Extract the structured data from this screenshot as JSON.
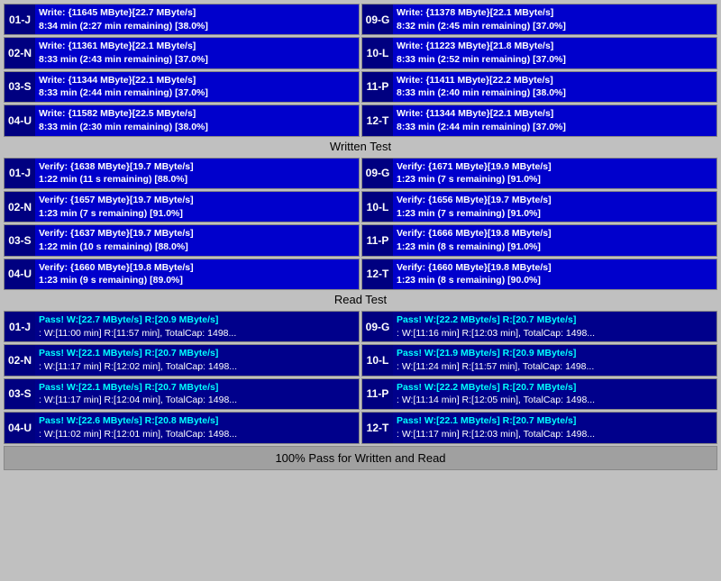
{
  "sections": {
    "write_label": "Written Test",
    "read_label": "Read Test",
    "pass_label": "100% Pass for Written and Read"
  },
  "write_rows": [
    {
      "left": {
        "id": "01-J",
        "line1": "Write: {11645 MByte}[22.7 MByte/s]",
        "line2": "8:34 min (2:27 min remaining)  [38.0%]"
      },
      "right": {
        "id": "09-G",
        "line1": "Write: {11378 MByte}[22.1 MByte/s]",
        "line2": "8:32 min (2:45 min remaining)  [37.0%]"
      }
    },
    {
      "left": {
        "id": "02-N",
        "line1": "Write: {11361 MByte}[22.1 MByte/s]",
        "line2": "8:33 min (2:43 min remaining)  [37.0%]"
      },
      "right": {
        "id": "10-L",
        "line1": "Write: {11223 MByte}[21.8 MByte/s]",
        "line2": "8:33 min (2:52 min remaining)  [37.0%]"
      }
    },
    {
      "left": {
        "id": "03-S",
        "line1": "Write: {11344 MByte}[22.1 MByte/s]",
        "line2": "8:33 min (2:44 min remaining)  [37.0%]"
      },
      "right": {
        "id": "11-P",
        "line1": "Write: {11411 MByte}[22.2 MByte/s]",
        "line2": "8:33 min (2:40 min remaining)  [38.0%]"
      }
    },
    {
      "left": {
        "id": "04-U",
        "line1": "Write: {11582 MByte}[22.5 MByte/s]",
        "line2": "8:33 min (2:30 min remaining)  [38.0%]"
      },
      "right": {
        "id": "12-T",
        "line1": "Write: {11344 MByte}[22.1 MByte/s]",
        "line2": "8:33 min (2:44 min remaining)  [37.0%]"
      }
    }
  ],
  "verify_rows": [
    {
      "left": {
        "id": "01-J",
        "line1": "Verify: {1638 MByte}[19.7 MByte/s]",
        "line2": "1:22 min (11 s remaining)  [88.0%]"
      },
      "right": {
        "id": "09-G",
        "line1": "Verify: {1671 MByte}[19.9 MByte/s]",
        "line2": "1:23 min (7 s remaining)  [91.0%]"
      }
    },
    {
      "left": {
        "id": "02-N",
        "line1": "Verify: {1657 MByte}[19.7 MByte/s]",
        "line2": "1:23 min (7 s remaining)  [91.0%]"
      },
      "right": {
        "id": "10-L",
        "line1": "Verify: {1656 MByte}[19.7 MByte/s]",
        "line2": "1:23 min (7 s remaining)  [91.0%]"
      }
    },
    {
      "left": {
        "id": "03-S",
        "line1": "Verify: {1637 MByte}[19.7 MByte/s]",
        "line2": "1:22 min (10 s remaining)  [88.0%]"
      },
      "right": {
        "id": "11-P",
        "line1": "Verify: {1666 MByte}[19.8 MByte/s]",
        "line2": "1:23 min (8 s remaining)  [91.0%]"
      }
    },
    {
      "left": {
        "id": "04-U",
        "line1": "Verify: {1660 MByte}[19.8 MByte/s]",
        "line2": "1:23 min (9 s remaining)  [89.0%]"
      },
      "right": {
        "id": "12-T",
        "line1": "Verify: {1660 MByte}[19.8 MByte/s]",
        "line2": "1:23 min (8 s remaining)  [90.0%]"
      }
    }
  ],
  "pass_rows": [
    {
      "left": {
        "id": "01-J",
        "line1": "Pass! W:[22.7 MByte/s] R:[20.9 MByte/s]",
        "line2": ": W:[11:00 min] R:[11:57 min], TotalCap: 1498..."
      },
      "right": {
        "id": "09-G",
        "line1": "Pass! W:[22.2 MByte/s] R:[20.7 MByte/s]",
        "line2": ": W:[11:16 min] R:[12:03 min], TotalCap: 1498..."
      }
    },
    {
      "left": {
        "id": "02-N",
        "line1": "Pass! W:[22.1 MByte/s] R:[20.7 MByte/s]",
        "line2": ": W:[11:17 min] R:[12:02 min], TotalCap: 1498..."
      },
      "right": {
        "id": "10-L",
        "line1": "Pass! W:[21.9 MByte/s] R:[20.9 MByte/s]",
        "line2": ": W:[11:24 min] R:[11:57 min], TotalCap: 1498..."
      }
    },
    {
      "left": {
        "id": "03-S",
        "line1": "Pass! W:[22.1 MByte/s] R:[20.7 MByte/s]",
        "line2": ": W:[11:17 min] R:[12:04 min], TotalCap: 1498..."
      },
      "right": {
        "id": "11-P",
        "line1": "Pass! W:[22.2 MByte/s] R:[20.7 MByte/s]",
        "line2": ": W:[11:14 min] R:[12:05 min], TotalCap: 1498..."
      }
    },
    {
      "left": {
        "id": "04-U",
        "line1": "Pass! W:[22.6 MByte/s] R:[20.8 MByte/s]",
        "line2": ": W:[11:02 min] R:[12:01 min], TotalCap: 1498..."
      },
      "right": {
        "id": "12-T",
        "line1": "Pass! W:[22.1 MByte/s] R:[20.7 MByte/s]",
        "line2": ": W:[11:17 min] R:[12:03 min], TotalCap: 1498..."
      }
    }
  ]
}
